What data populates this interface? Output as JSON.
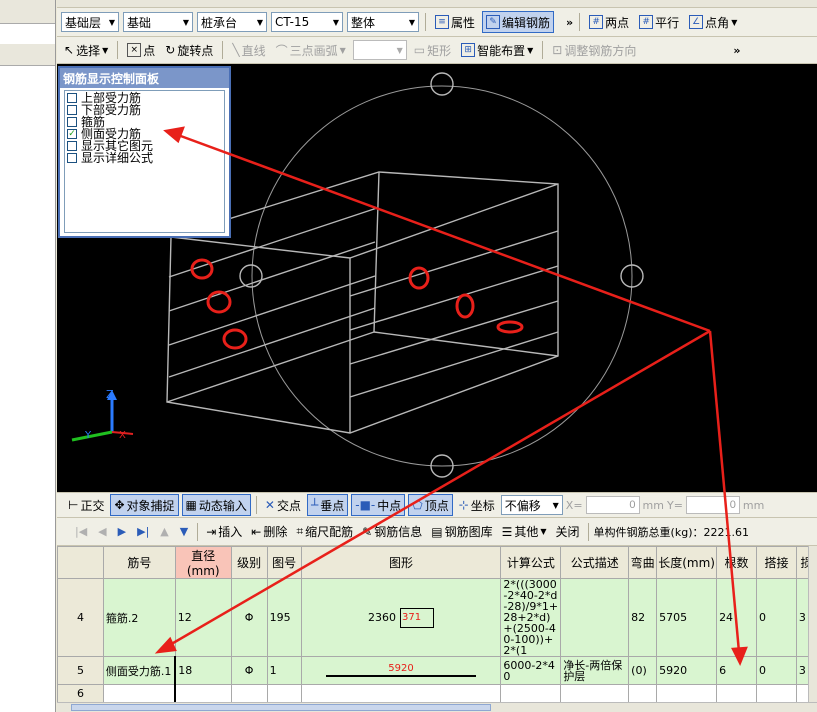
{
  "toolbar_row1": {
    "layer": "基础层",
    "category": "基础",
    "component_type": "桩承台",
    "component_name": "CT-15",
    "scope": "整体",
    "properties_label": "属性",
    "edit_rebar_label": "编辑钢筋",
    "two_points_label": "两点",
    "parallel_label": "平行",
    "point_angle_label": "点角"
  },
  "toolbar_row2": {
    "select_label": "选择",
    "point_label": "点",
    "rotate_point_label": "旋转点",
    "line_label": "直线",
    "three_point_arc_label": "三点画弧",
    "rectangle_label": "矩形",
    "smart_layout_label": "智能布置",
    "adjust_direction_label": "调整钢筋方向"
  },
  "control_panel": {
    "title": "钢筋显示控制面板",
    "items": [
      {
        "label": "上部受力筋",
        "checked": false
      },
      {
        "label": "下部受力筋",
        "checked": false
      },
      {
        "label": "箍筋",
        "checked": false
      },
      {
        "label": "侧面受力筋",
        "checked": true
      },
      {
        "label": "显示其它图元",
        "checked": false
      },
      {
        "label": "显示详细公式",
        "checked": false
      }
    ]
  },
  "axes": {
    "x": "X",
    "y": "Y",
    "z": "Z"
  },
  "status_bar": {
    "ortho_label": "正交",
    "snap_label": "对象捕捉",
    "dynamic_input_label": "动态输入",
    "intersection_label": "交点",
    "perpendicular_label": "垂点",
    "midpoint_label": "中点",
    "vertex_label": "顶点",
    "coordinate_label": "坐标",
    "offset_mode": "不偏移",
    "x_label": "X=",
    "x_value": "0",
    "x_unit": "mm",
    "y_label": "Y=",
    "y_value": "0",
    "y_unit": "mm"
  },
  "table_toolbar": {
    "insert_label": "插入",
    "delete_label": "删除",
    "scale_rebar_label": "缩尺配筋",
    "rebar_info_label": "钢筋信息",
    "rebar_library_label": "钢筋图库",
    "other_label": "其他",
    "close_label": "关闭",
    "total_weight_label": "单构件钢筋总重(kg)：2221.61"
  },
  "table": {
    "headers": [
      "筋号",
      "直径(mm)",
      "级别",
      "图号",
      "图形",
      "计算公式",
      "公式描述",
      "弯曲",
      "长度(mm)",
      "根数",
      "搭接",
      "损"
    ],
    "rows": [
      {
        "num": "4",
        "name": "箍筋.2",
        "diameter": "12",
        "grade": "Φ",
        "shape_no": "195",
        "shape_dim1": "2360",
        "shape_dim2": "371",
        "formula": "2*(((3000-2*40-2*d-28)/9*1+28+2*d)+(2500-40-100))+2*(1",
        "description": "",
        "bend": "82",
        "length": "5705",
        "count": "24",
        "lap": "0",
        "loss": "3"
      },
      {
        "num": "5",
        "name": "侧面受力筋.1",
        "diameter": "18",
        "grade": "Φ",
        "shape_no": "1",
        "shape_dim1": "5920",
        "shape_dim2": "",
        "formula": "6000-2*40",
        "description": "净长-两倍保护层",
        "bend": "(0)",
        "length": "5920",
        "count": "6",
        "lap": "0",
        "loss": "3"
      },
      {
        "num": "6",
        "name": "",
        "diameter": "",
        "grade": "",
        "shape_no": "",
        "shape_dim1": "",
        "shape_dim2": "",
        "formula": "",
        "description": "",
        "bend": "",
        "length": "",
        "count": "",
        "lap": "",
        "loss": ""
      }
    ]
  },
  "colors": {
    "annotation_red": "#e8201a",
    "selected_row_green": "#d9f5d0",
    "header_highlight": "#f9c4b8",
    "canvas_bg": "#000000",
    "wire_gray": "#b8b8b8"
  }
}
